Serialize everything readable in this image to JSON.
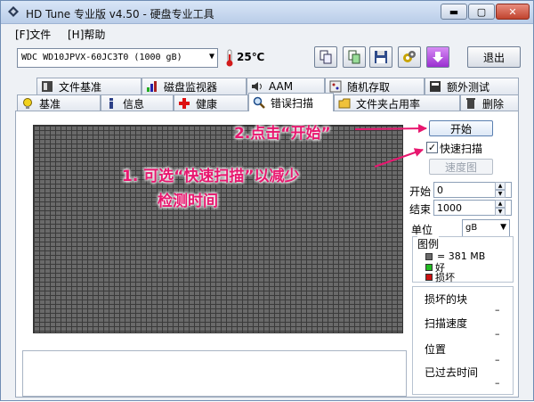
{
  "window": {
    "title": "HD Tune 专业版 v4.50 - 硬盘专业工具",
    "minimize": "▬",
    "maximize": "▢",
    "close": "✕"
  },
  "menu": {
    "file": "[F]文件",
    "help": "[H]帮助"
  },
  "toolbar": {
    "drive": "WDC WD10JPVX-60JC3T0      (1000 gB)",
    "temperature": "25℃",
    "exit": "退出"
  },
  "tabs_top": [
    "文件基准",
    "磁盘监视器",
    "AAM",
    "随机存取",
    "额外测试"
  ],
  "tabs_bottom": [
    "基准",
    "信息",
    "健康",
    "错误扫描",
    "文件夹占用率",
    "删除"
  ],
  "active_tab": "错误扫描",
  "scan": {
    "start_button": "开始",
    "quick_scan_label": "快速扫描",
    "quick_scan_checked": "✓",
    "map_button": "速度图",
    "start_label": "开始",
    "start_value": "0",
    "end_label": "结束",
    "end_value": "1000",
    "unit_label": "单位",
    "unit_value": "gB",
    "legend_title": "图例",
    "legend_block": "= 381 MB",
    "legend_good": "好",
    "legend_bad": "损坏",
    "damaged_blocks_label": "损坏的块",
    "scan_speed_label": "扫描速度",
    "position_label": "位置",
    "elapsed_label": "已过去时间",
    "dash": "–"
  },
  "annotations": {
    "step2": "2.点击“开始”",
    "step1_line1": "1.  可选“快速扫描”以减少",
    "step1_line2": "检测时间"
  },
  "colors": {
    "annotation": "#e8176f",
    "block_gray": "#6a6a6a",
    "good_green": "#22bb22",
    "bad_red": "#cc1111"
  }
}
